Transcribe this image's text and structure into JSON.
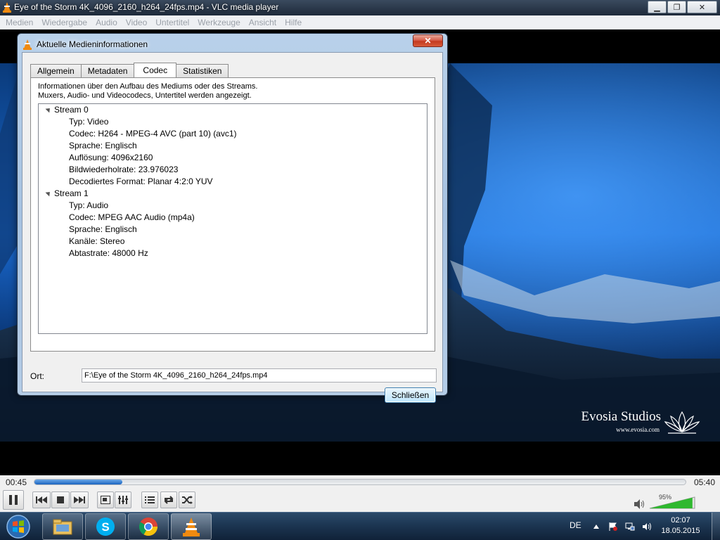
{
  "window": {
    "title": "Eye of the Storm 4K_4096_2160_h264_24fps.mp4 - VLC media player",
    "minimize_glyph": "▁",
    "maximize_glyph": "❐",
    "close_glyph": "✕"
  },
  "menubar": {
    "items": [
      "Medien",
      "Wiedergabe",
      "Audio",
      "Video",
      "Untertitel",
      "Werkzeuge",
      "Ansicht",
      "Hilfe"
    ]
  },
  "video": {
    "watermark_brand": "Evosia Studios",
    "watermark_site": "www.evosia.com"
  },
  "dialog": {
    "title": "Aktuelle Medieninformationen",
    "close_glyph": "✕",
    "tabs": [
      {
        "label": "Allgemein",
        "active": false
      },
      {
        "label": "Metadaten",
        "active": false
      },
      {
        "label": "Codec",
        "active": true
      },
      {
        "label": "Statistiken",
        "active": false
      }
    ],
    "description_line1": "Informationen über den Aufbau des Mediums oder des Streams.",
    "description_line2": "Muxers, Audio- und Videocodecs, Untertitel werden angezeigt.",
    "streams": [
      {
        "label": "Stream 0",
        "props": [
          "Typ: Video",
          "Codec: H264 - MPEG-4 AVC (part 10) (avc1)",
          "Sprache: Englisch",
          "Auflösung: 4096x2160",
          "Bildwiederholrate: 23.976023",
          "Decodiertes Format: Planar 4:2:0 YUV"
        ]
      },
      {
        "label": "Stream 1",
        "props": [
          "Typ: Audio",
          "Codec: MPEG AAC Audio (mp4a)",
          "Sprache: Englisch",
          "Kanäle: Stereo",
          "Abtastrate: 48000 Hz"
        ]
      }
    ],
    "location_label": "Ort:",
    "location_value": "F:\\Eye of the Storm 4K_4096_2160_h264_24fps.mp4",
    "close_button": "Schließen"
  },
  "player": {
    "elapsed": "00:45",
    "total": "05:40",
    "progress_fraction": 0.135,
    "volume": "95%",
    "volume_fraction": 0.95
  },
  "taskbar": {
    "language": "DE",
    "time": "02:07",
    "date": "18.05.2015",
    "apps": [
      "file-explorer",
      "skype",
      "chrome",
      "vlc"
    ]
  },
  "colors": {
    "accent": "#1a64c0",
    "vlc_orange": "#f08a10",
    "volume_green": "#2fb82f"
  }
}
